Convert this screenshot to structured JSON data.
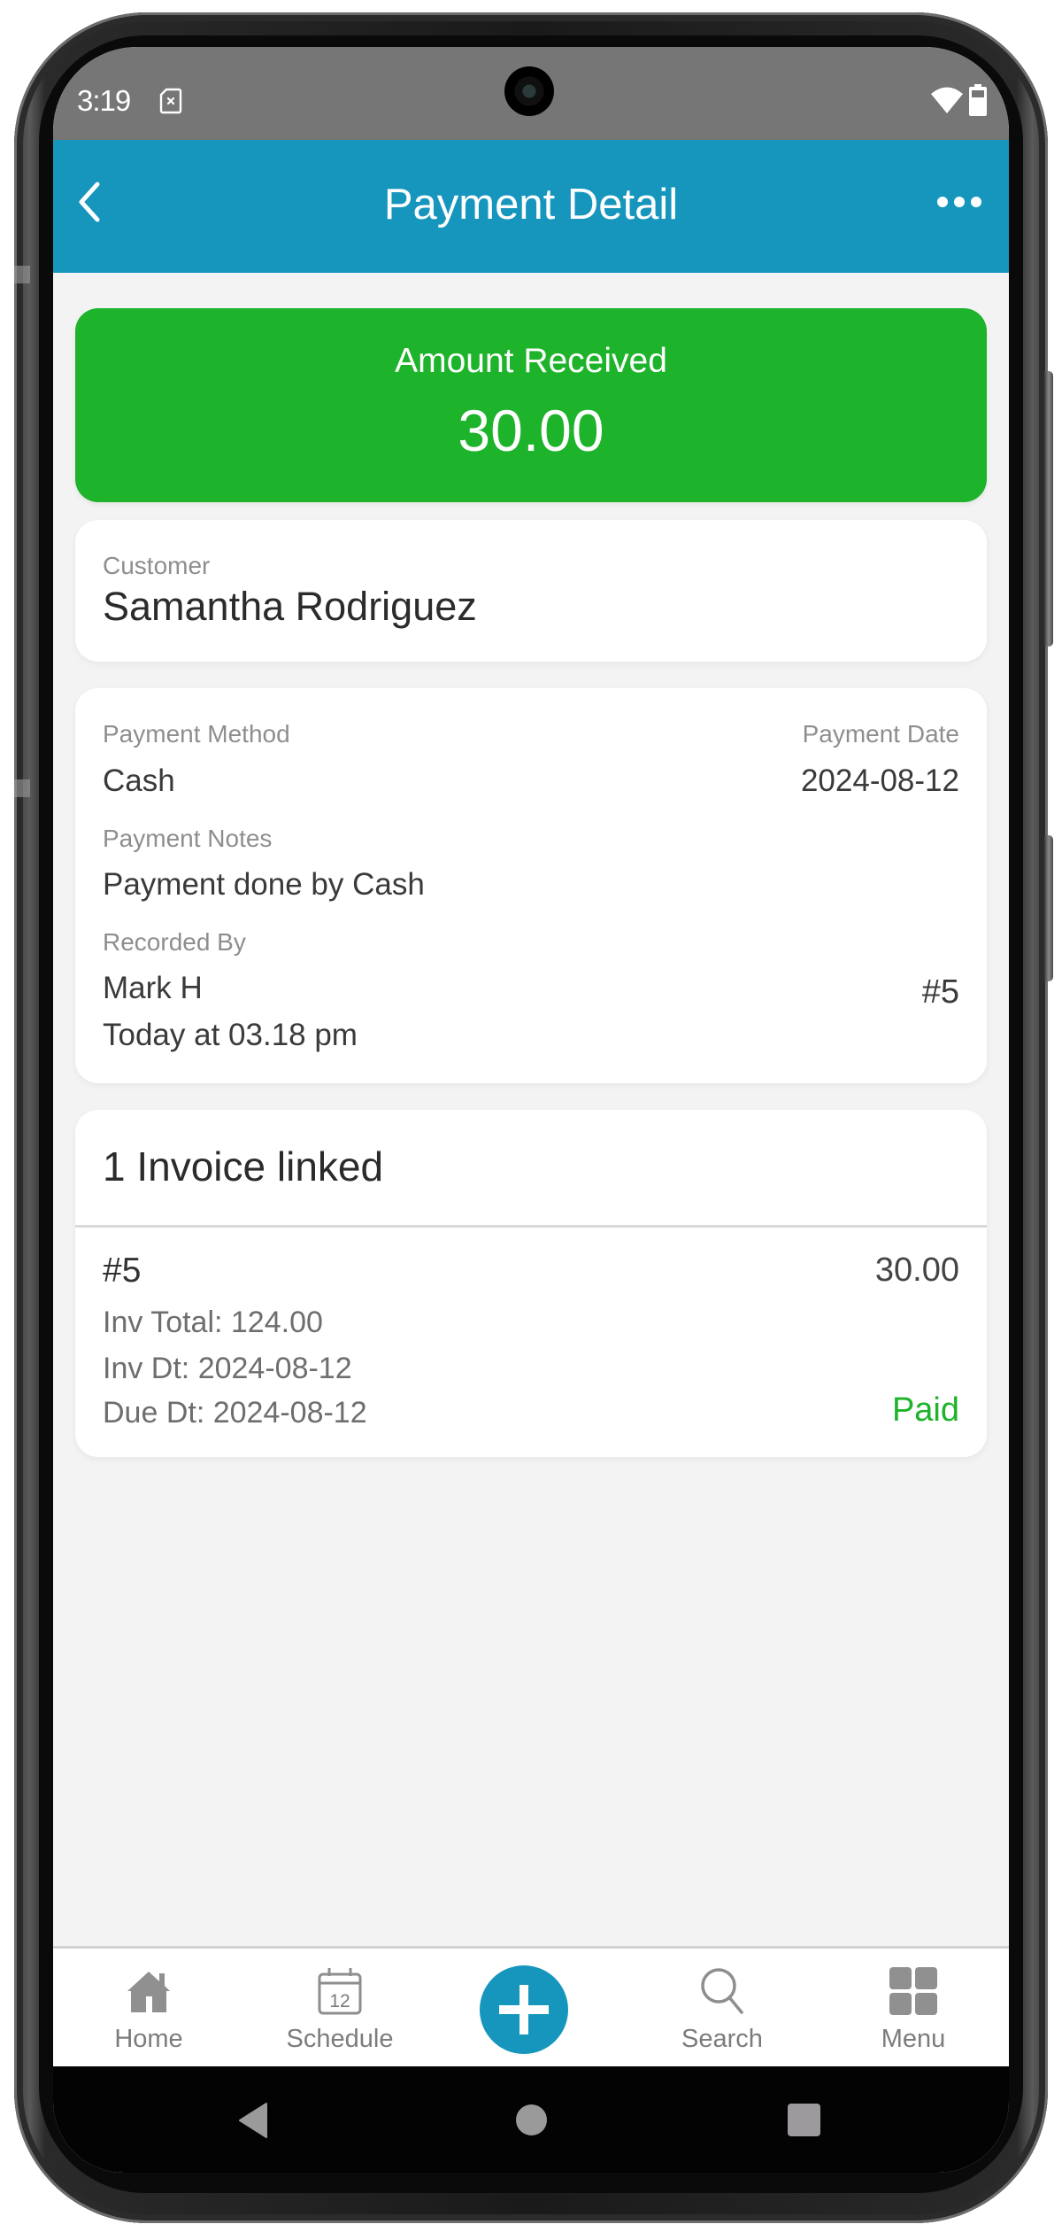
{
  "status_bar": {
    "time": "3:19",
    "icons": [
      "sim-card-absent-icon",
      "wifi-icon",
      "battery-icon"
    ]
  },
  "header": {
    "title": "Payment Detail",
    "back_icon": "chevron-left-icon",
    "more_icon": "more-horizontal-icon",
    "color": "#1696BD"
  },
  "amount_card": {
    "label": "Amount Received",
    "value": "30.00",
    "color": "#1DB32A"
  },
  "customer": {
    "label": "Customer",
    "name": "Samantha Rodriguez"
  },
  "details": {
    "payment_method_label": "Payment Method",
    "payment_method": "Cash",
    "payment_date_label": "Payment Date",
    "payment_date": "2024-08-12",
    "notes_label": "Payment Notes",
    "notes": "Payment done by Cash",
    "recorded_by_label": "Recorded By",
    "recorded_by": "Mark H",
    "recorded_at": "Today at 03.18 pm",
    "payment_number": "#5"
  },
  "invoices": {
    "header": "1 Invoice linked",
    "items": [
      {
        "number": "#5",
        "amount": "30.00",
        "total": "Inv Total: 124.00",
        "invoice_date": "Inv Dt: 2024-08-12",
        "due_date": "Due Dt: 2024-08-12",
        "status": "Paid",
        "status_color": "#1DB32A"
      }
    ]
  },
  "bottom_nav": {
    "items": [
      {
        "label": "Home",
        "icon": "home-icon"
      },
      {
        "label": "Schedule",
        "icon": "calendar-icon",
        "icon_text": "12"
      },
      {
        "label": "",
        "icon": "plus-icon"
      },
      {
        "label": "Search",
        "icon": "search-icon"
      },
      {
        "label": "Menu",
        "icon": "grid-icon"
      }
    ]
  },
  "system_nav": {
    "buttons": [
      "back",
      "home",
      "recents"
    ]
  }
}
